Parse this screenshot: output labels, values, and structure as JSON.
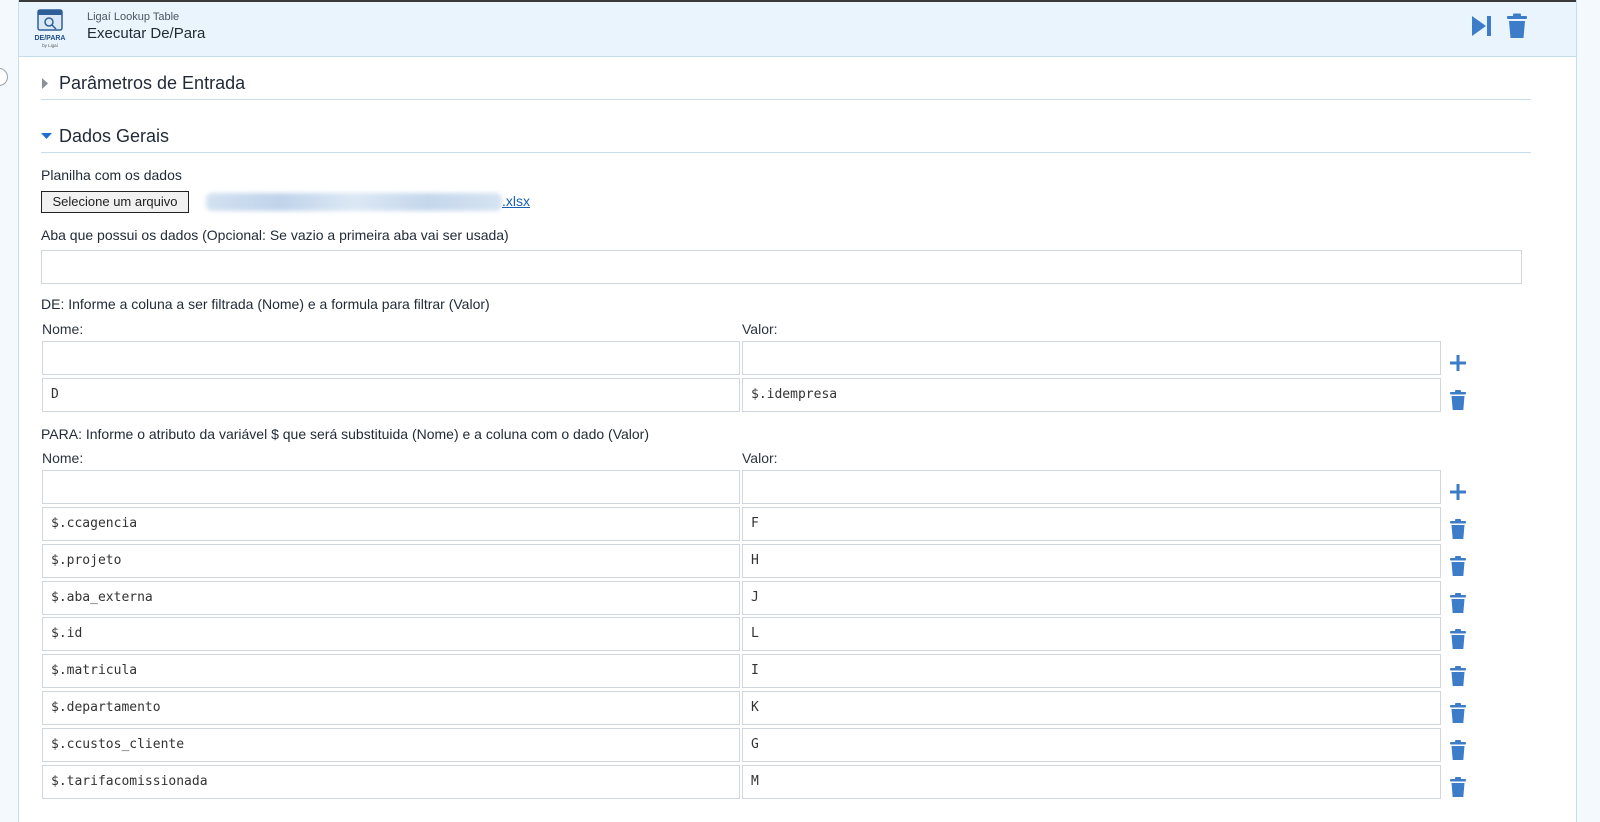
{
  "header": {
    "subtitle": "Ligaí Lookup Table",
    "title": "Executar De/Para",
    "logo_text": "DE/PARA",
    "logo_byline": "by Ligaí"
  },
  "sections": {
    "params_title": "Parâmetros de Entrada",
    "general_title": "Dados Gerais"
  },
  "file": {
    "label": "Planilha com os dados",
    "button_label": "Selecione um arquivo",
    "file_ext": ".xlsx"
  },
  "sheet": {
    "label": "Aba que possui os dados (Opcional: Se vazio a primeira aba vai ser usada)",
    "value": ""
  },
  "de": {
    "label": "DE: Informe a coluna a ser filtrada (Nome) e a formula para filtrar (Valor)",
    "name_header": "Nome:",
    "value_header": "Valor:",
    "new_name": "",
    "new_value": "",
    "rows": [
      {
        "name": "D",
        "value": "$.idempresa"
      }
    ]
  },
  "para": {
    "label": "PARA: Informe o atributo da variável $ que será substituida (Nome) e a coluna com o dado (Valor)",
    "name_header": "Nome:",
    "value_header": "Valor:",
    "new_name": "",
    "new_value": "",
    "rows": [
      {
        "name": "$.ccagencia",
        "value": "F"
      },
      {
        "name": "$.projeto",
        "value": "H"
      },
      {
        "name": "$.aba_externa",
        "value": "J"
      },
      {
        "name": "$.id",
        "value": "L"
      },
      {
        "name": "$.matricula",
        "value": "I"
      },
      {
        "name": "$.departamento",
        "value": "K"
      },
      {
        "name": "$.ccustos_cliente",
        "value": "G"
      },
      {
        "name": "$.tarifacomissionada",
        "value": "M"
      }
    ]
  },
  "colors": {
    "accent": "#3d7cc9",
    "header_bg": "#eaf4fc",
    "link": "#1a5fb4"
  },
  "icons": {
    "run": "skip-forward-icon",
    "delete": "trash-icon",
    "add": "plus-icon",
    "collapsed": "caret-right-icon",
    "expanded": "caret-down-icon"
  }
}
